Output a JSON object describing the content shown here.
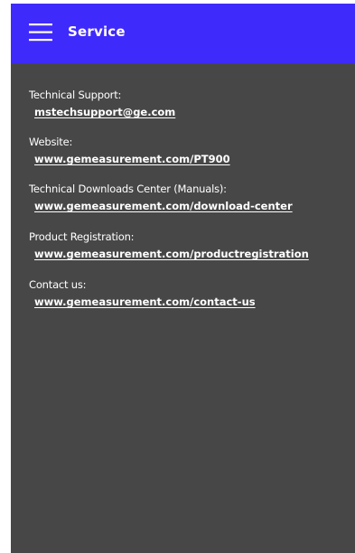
{
  "header": {
    "title": "Service",
    "menu_icon": "hamburger-menu-icon",
    "background_color": "#3f2afc"
  },
  "content": {
    "background_color": "#474747",
    "entries": [
      {
        "label": "Technical Support:",
        "link": "mstechsupport@ge.com"
      },
      {
        "label": "Website:",
        "link": "www.gemeasurement.com/PT900"
      },
      {
        "label": "Technical Downloads Center (Manuals):",
        "link": "www.gemeasurement.com/download-center"
      },
      {
        "label": "Product Registration:",
        "link": "www.gemeasurement.com/productregistration"
      },
      {
        "label": "Contact us:",
        "link": "www.gemeasurement.com/contact-us"
      }
    ]
  }
}
